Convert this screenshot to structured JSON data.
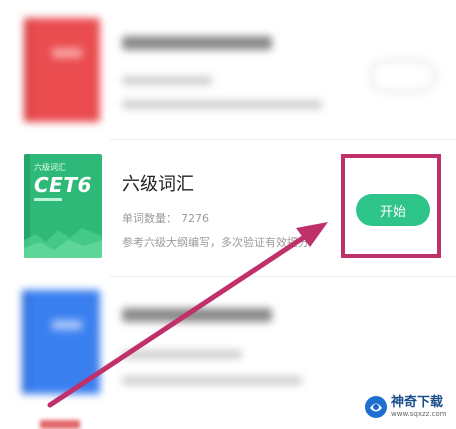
{
  "book": {
    "cover_brand": "六级词汇",
    "cover_title": "CET6",
    "title": "六级词汇",
    "word_count_label": "单词数量：",
    "word_count_value": "7276",
    "description": "参考六级大纲编写，多次验证有效提分",
    "start_label": "开始"
  },
  "watermark": {
    "name": "神奇下载",
    "url": "www.sqxzz.com"
  },
  "colors": {
    "accent_green": "#2ec48a",
    "highlight_magenta": "#c0306b",
    "red_cover": "#ea4c4f",
    "blue_cover": "#3a7ff0",
    "cet_cover": "#2fb978"
  }
}
